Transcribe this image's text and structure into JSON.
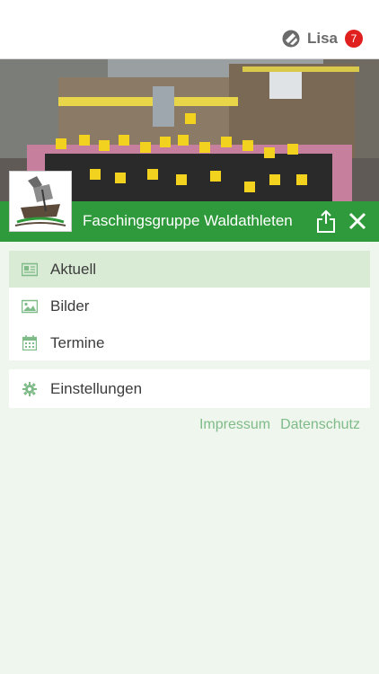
{
  "header": {
    "username": "Lisa",
    "badge_count": "7",
    "app_icon": "app-logo-icon"
  },
  "club": {
    "title": "Faschingsgruppe Waldathleten",
    "logo_icon": "club-logo",
    "share_icon": "share-icon",
    "close_icon": "close-icon"
  },
  "menu": {
    "items": [
      {
        "label": "Aktuell",
        "icon": "newspaper-icon",
        "active": true
      },
      {
        "label": "Bilder",
        "icon": "image-icon",
        "active": false
      },
      {
        "label": "Termine",
        "icon": "calendar-icon",
        "active": false
      }
    ],
    "settings": {
      "label": "Einstellungen",
      "icon": "gear-icon"
    }
  },
  "footer_links": {
    "impressum": "Impressum",
    "datenschutz": "Datenschutz"
  },
  "colors": {
    "accent": "#2f9a3b",
    "active_item": "#d9ead5",
    "link": "#7fbb88",
    "badge": "#e0201e",
    "background": "#eff6ee"
  }
}
